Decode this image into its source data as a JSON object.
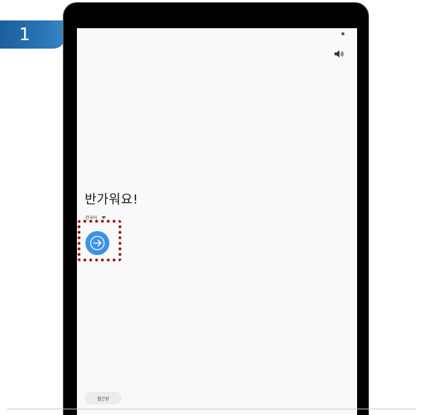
{
  "step": {
    "number": "1",
    "color": "#2a6fad"
  },
  "status_bar": {
    "indicator_icon": "status-dot",
    "sound_icon": "volume-icon"
  },
  "welcome": {
    "greeting": "반가워요!",
    "language": {
      "selected": "한국어",
      "icon": "chevron-down-icon"
    },
    "next_button": {
      "icon": "arrow-right-icon",
      "color": "#3c92e6"
    }
  },
  "highlight": {
    "color": "#a30f17",
    "style": "dotted"
  },
  "footer": {
    "accessibility_label": "접근성"
  }
}
